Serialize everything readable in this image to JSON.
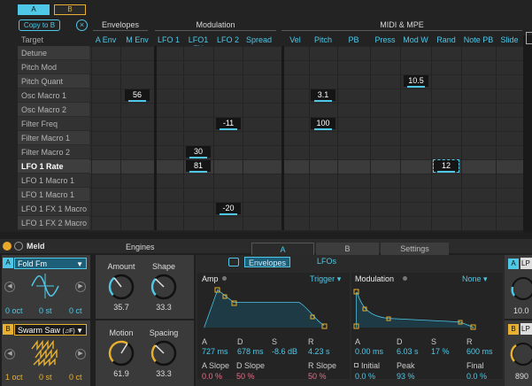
{
  "matrix": {
    "tab_a": "A",
    "tab_b": "B",
    "copy_label": "Copy to B",
    "target_label": "Target",
    "groups": [
      {
        "label": "Envelopes"
      },
      {
        "label": "Modulation"
      },
      {
        "label": "MIDI & MPE"
      }
    ],
    "columns": [
      "A Env",
      "M Env",
      "LFO 1",
      "LFO1 FX",
      "LFO 2",
      "Spread",
      "Vel",
      "Pitch",
      "PB",
      "Press",
      "Mod W",
      "Rand",
      "Note PB",
      "Slide"
    ],
    "rows": [
      "Detune",
      "Pitch Mod",
      "Pitch Quant",
      "Osc Macro 1",
      "Osc Macro 2",
      "Filter Freq",
      "Filter Macro 1",
      "Filter Macro 2",
      "LFO 1 Rate",
      "LFO 1 Macro 1",
      "LFO 1 Macro 1",
      "LFO 1 FX 1 Macro",
      "LFO 1 FX 2 Macro"
    ],
    "cells": [
      {
        "row": 2,
        "col": 10,
        "value": "10.5"
      },
      {
        "row": 3,
        "col": 1,
        "value": "56"
      },
      {
        "row": 3,
        "col": 7,
        "value": "3.1"
      },
      {
        "row": 5,
        "col": 4,
        "value": "-11"
      },
      {
        "row": 5,
        "col": 7,
        "value": "100"
      },
      {
        "row": 7,
        "col": 3,
        "value": "30"
      },
      {
        "row": 8,
        "col": 3,
        "value": "81"
      },
      {
        "row": 8,
        "col": 11,
        "value": "12"
      },
      {
        "row": 11,
        "col": 4,
        "value": "-20"
      }
    ]
  },
  "device": {
    "title": "Meld",
    "engines_label": "Engines",
    "tabs": [
      "A",
      "B",
      "Settings"
    ],
    "engine_a": {
      "badge": "A",
      "type": "Fold Fm",
      "oct": "0 oct",
      "st": "0 st",
      "oct2": "0 ct"
    },
    "engine_b": {
      "badge": "B",
      "type": "Swarm Saw",
      "type_suffix": "(♫F)",
      "oct": "1 oct",
      "st": "0 st",
      "oct2": "0 ct"
    },
    "knobs": [
      {
        "label": "Amount",
        "value": "35.7",
        "level": 0.36
      },
      {
        "label": "Shape",
        "value": "33.3",
        "level": 0.33
      },
      {
        "label": "Motion",
        "value": "61.9",
        "level": 0.62
      },
      {
        "label": "Spacing",
        "value": "33.3",
        "level": 0.33
      }
    ],
    "env_tabs": {
      "envelopes": "Envelopes",
      "lfos": "LFOs"
    },
    "amp": {
      "title": "Amp",
      "mode": "Trigger",
      "labels": [
        "A",
        "D",
        "S",
        "R"
      ],
      "values": [
        "727 ms",
        "678 ms",
        "-8.6 dB",
        "4.23 s"
      ],
      "slope_labels": [
        "A Slope",
        "D Slope",
        "R Slope"
      ],
      "slope_values": [
        "0.0 %",
        "50 %",
        "50 %"
      ]
    },
    "modenv": {
      "title": "Modulation",
      "mode": "None",
      "labels": [
        "A",
        "D",
        "S",
        "R"
      ],
      "values": [
        "0.00 ms",
        "6.03 s",
        "17 %",
        "600 ms"
      ],
      "extra_labels": [
        "Initial",
        "Peak",
        "Final"
      ],
      "extra_values": [
        "0.0 %",
        "93 %",
        "0.0 %"
      ]
    },
    "right": {
      "lp1": "LP",
      "val1": "10.0",
      "badge_b": "B",
      "lp2": "LP",
      "val2": "890"
    }
  }
}
